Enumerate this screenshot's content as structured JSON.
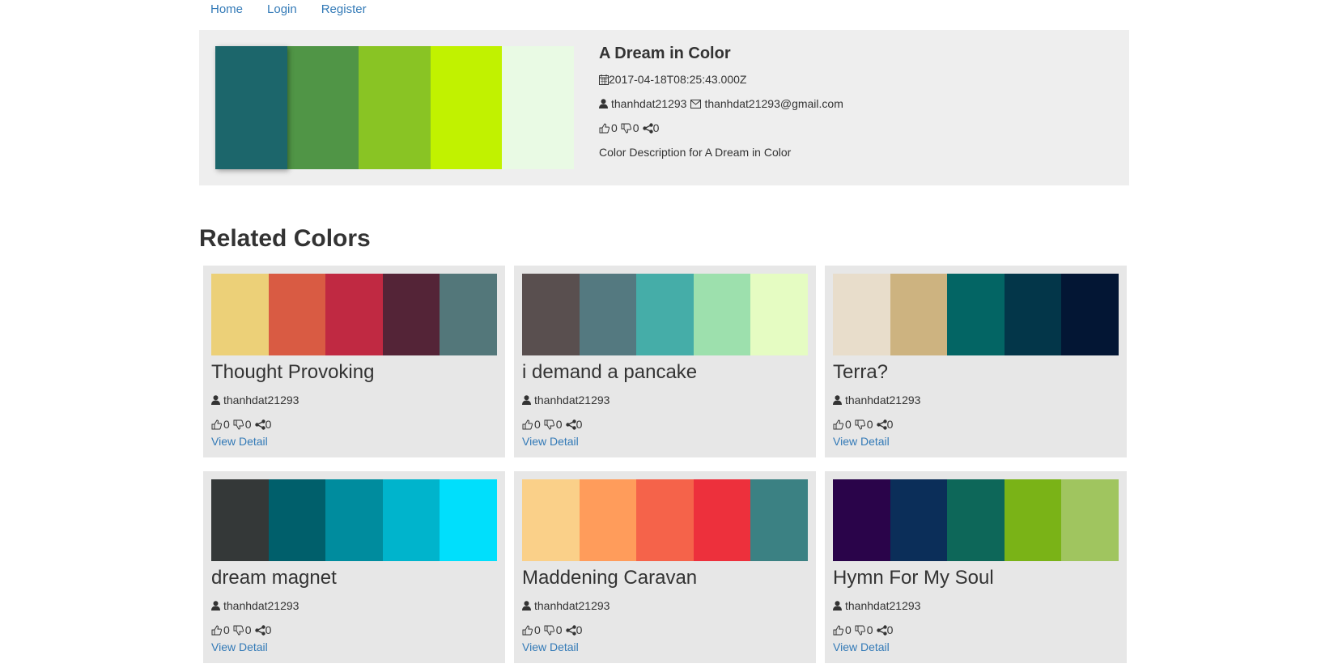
{
  "nav": {
    "home": "Home",
    "login": "Login",
    "register": "Register"
  },
  "feature": {
    "title": "A Dream in Color",
    "date": "2017-04-18T08:25:43.000Z",
    "author": "thanhdat21293",
    "email": "thanhdat21293@gmail.com",
    "likes": "0",
    "dislikes": "0",
    "shares": "0",
    "description": "Color Description for A Dream in Color",
    "colors": [
      "#1c666b",
      "#509546",
      "#89c424",
      "#c1f200",
      "#e9fae4"
    ]
  },
  "related": {
    "heading": "Related Colors",
    "cards": [
      {
        "title": "Thought Provoking",
        "author": "thanhdat21293",
        "likes": "0",
        "dislikes": "0",
        "shares": "0",
        "link": "View Detail",
        "colors": [
          "#ecd078",
          "#d95b43",
          "#c02942",
          "#542437",
          "#53777a"
        ]
      },
      {
        "title": "i demand a pancake",
        "author": "thanhdat21293",
        "likes": "0",
        "dislikes": "0",
        "shares": "0",
        "link": "View Detail",
        "colors": [
          "#594f4f",
          "#547980",
          "#45ada8",
          "#9de0ad",
          "#e5fcc2"
        ]
      },
      {
        "title": "Terra?",
        "author": "thanhdat21293",
        "likes": "0",
        "dislikes": "0",
        "shares": "0",
        "link": "View Detail",
        "colors": [
          "#e8ddcb",
          "#cdb380",
          "#036564",
          "#033649",
          "#031634"
        ]
      },
      {
        "title": "dream magnet",
        "author": "thanhdat21293",
        "likes": "0",
        "dislikes": "0",
        "shares": "0",
        "link": "View Detail",
        "colors": [
          "#343838",
          "#005f6b",
          "#008c9e",
          "#00b4cc",
          "#00dffc"
        ]
      },
      {
        "title": "Maddening Caravan",
        "author": "thanhdat21293",
        "likes": "0",
        "dislikes": "0",
        "shares": "0",
        "link": "View Detail",
        "colors": [
          "#fad089",
          "#ff9c5b",
          "#f5634a",
          "#ed303c",
          "#3b8183"
        ]
      },
      {
        "title": "Hymn For My Soul",
        "author": "thanhdat21293",
        "likes": "0",
        "dislikes": "0",
        "shares": "0",
        "link": "View Detail",
        "colors": [
          "#2a044a",
          "#0b2e59",
          "#0d6759",
          "#7ab317",
          "#a0c55f"
        ]
      }
    ]
  }
}
